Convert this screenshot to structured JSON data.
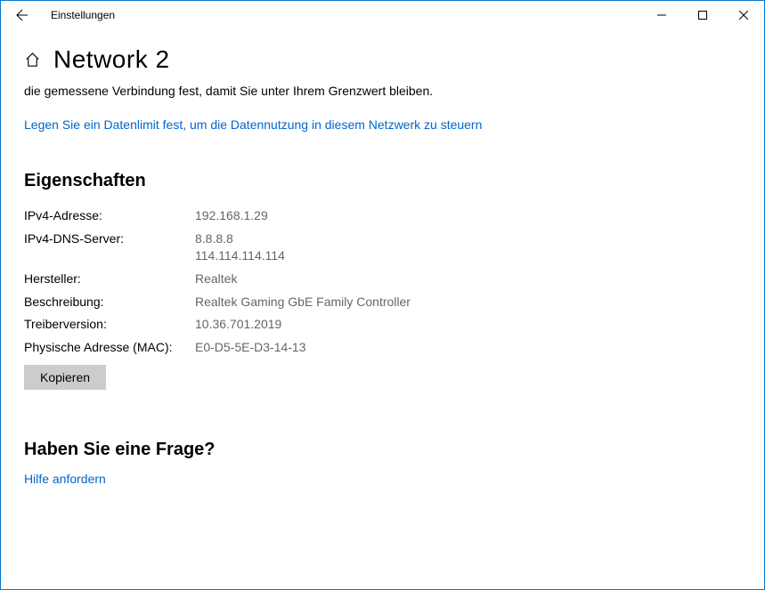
{
  "window": {
    "title": "Einstellungen"
  },
  "header": {
    "page_title": "Network  2"
  },
  "description_text": "die gemessene Verbindung fest, damit Sie unter Ihrem Grenzwert bleiben.",
  "data_limit_link": "Legen Sie ein Datenlimit fest, um die Datennutzung in diesem Netzwerk zu steuern",
  "properties": {
    "title": "Eigenschaften",
    "rows": [
      {
        "label": "IPv4-Adresse:",
        "value": "192.168.1.29"
      },
      {
        "label": "IPv4-DNS-Server:",
        "value": "8.8.8.8\n114.114.114.114"
      },
      {
        "label": "Hersteller:",
        "value": "Realtek"
      },
      {
        "label": "Beschreibung:",
        "value": "Realtek Gaming GbE Family Controller"
      },
      {
        "label": "Treiberversion:",
        "value": "10.36.701.2019"
      },
      {
        "label": "Physische Adresse (MAC):",
        "value": "E0-D5-5E-D3-14-13"
      }
    ],
    "copy_label": "Kopieren"
  },
  "help": {
    "title": "Haben Sie eine Frage?",
    "link": "Hilfe anfordern"
  }
}
